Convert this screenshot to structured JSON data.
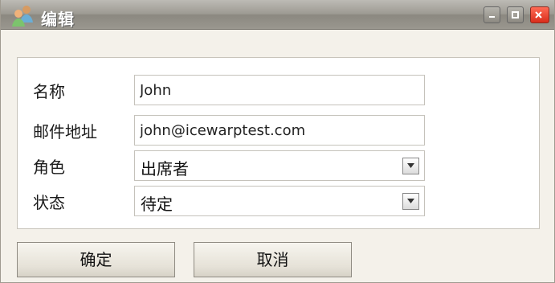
{
  "window": {
    "title": "编辑",
    "controls": {
      "minimize": "minimize-icon",
      "maximize": "maximize-icon",
      "close": "close-icon"
    }
  },
  "form": {
    "name": {
      "label": "名称",
      "value": "John"
    },
    "email": {
      "label": "邮件地址",
      "value": "john@icewarptest.com"
    },
    "role": {
      "label": "角色",
      "value": "出席者"
    },
    "status": {
      "label": "状态",
      "value": "待定"
    }
  },
  "actions": {
    "ok": "确定",
    "cancel": "取消"
  },
  "colors": {
    "title_bar": "#9d9a92",
    "window_bg": "#f4f1ea",
    "close_button": "#d92d1b"
  }
}
